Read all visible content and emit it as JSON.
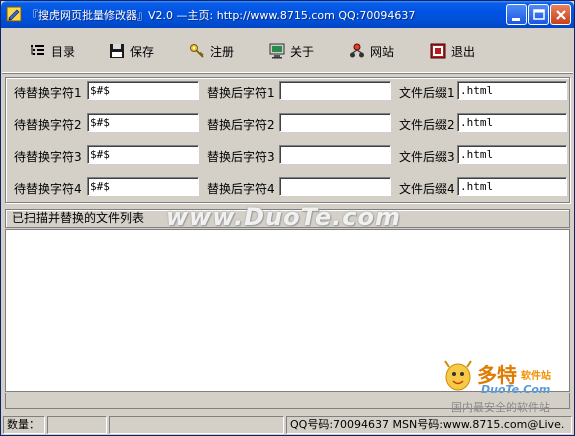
{
  "title": "『搜虎网页批量修改器』V2.0 —主页: http://www.8715.com QQ:70094637",
  "toolbar": {
    "items": [
      {
        "label": "目录",
        "icon": "directory-icon"
      },
      {
        "label": "保存",
        "icon": "save-icon"
      },
      {
        "label": "注册",
        "icon": "key-icon"
      },
      {
        "label": "关于",
        "icon": "monitor-icon"
      },
      {
        "label": "网站",
        "icon": "network-icon"
      },
      {
        "label": "退出",
        "icon": "exit-icon"
      }
    ]
  },
  "form": {
    "rows": [
      {
        "find_label": "待替换字符1",
        "find_value": "$#$",
        "replace_label": "替换后字符1",
        "replace_value": "",
        "ext_label": "文件后缀1",
        "ext_value": ".html"
      },
      {
        "find_label": "待替换字符2",
        "find_value": "$#$",
        "replace_label": "替换后字符2",
        "replace_value": "",
        "ext_label": "文件后缀2",
        "ext_value": ".html"
      },
      {
        "find_label": "待替换字符3",
        "find_value": "$#$",
        "replace_label": "替换后字符3",
        "replace_value": "",
        "ext_label": "文件后缀3",
        "ext_value": ".html"
      },
      {
        "find_label": "待替换字符4",
        "find_value": "$#$",
        "replace_label": "替换后字符4",
        "replace_value": "",
        "ext_label": "文件后缀4",
        "ext_value": ".html"
      }
    ]
  },
  "list": {
    "header": "已扫描并替换的文件列表"
  },
  "watermark": {
    "text": "www.DuoTe.com",
    "logo_cn": "多特",
    "logo_sub": "软件站",
    "logo_en": "DuoTe.Com",
    "logo_cn2": "国内最安全的软件站"
  },
  "statusbar": {
    "count_label": "数量：",
    "count_value": "",
    "contact": "QQ号码:70094637 MSN号码:www.8715.com@Live."
  },
  "colors": {
    "titlebar": "#0054e3",
    "face": "#d4d0c8"
  }
}
